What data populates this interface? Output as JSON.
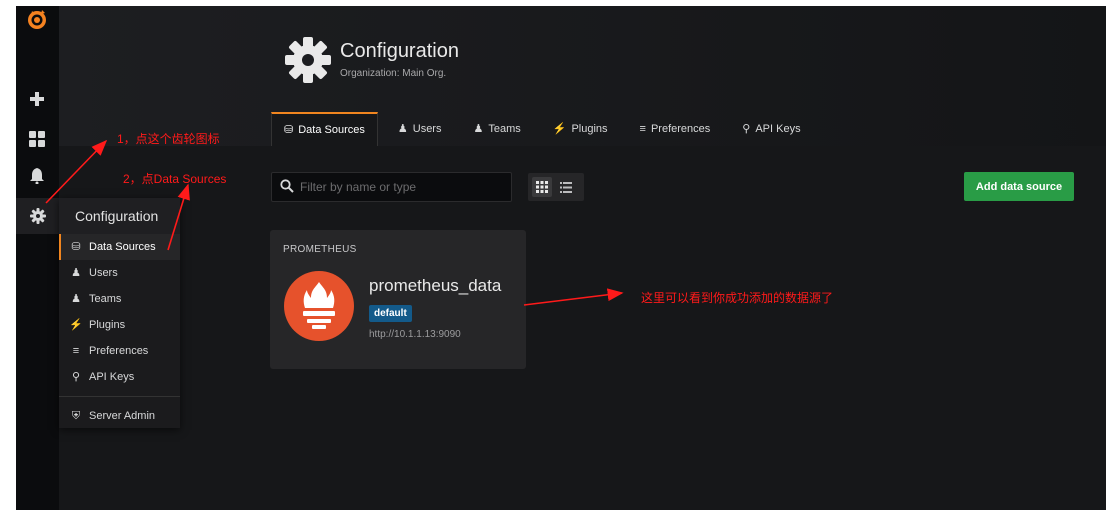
{
  "sidebar": {
    "icons": [
      "grafana-logo-icon",
      "plus-icon",
      "dashboards-icon",
      "bell-icon",
      "gear-icon"
    ]
  },
  "config_menu": {
    "title": "Configuration",
    "items": [
      {
        "label": "Data Sources",
        "icon": "database-icon",
        "active": true
      },
      {
        "label": "Users",
        "icon": "user-icon"
      },
      {
        "label": "Teams",
        "icon": "team-icon"
      },
      {
        "label": "Plugins",
        "icon": "plug-icon"
      },
      {
        "label": "Preferences",
        "icon": "sliders-icon"
      },
      {
        "label": "API Keys",
        "icon": "key-icon"
      }
    ],
    "server_admin": "Server Admin"
  },
  "header": {
    "title": "Configuration",
    "subtitle": "Organization: Main Org."
  },
  "tabs": [
    {
      "label": "Data Sources",
      "icon": "database-icon",
      "active": true
    },
    {
      "label": "Users",
      "icon": "user-icon"
    },
    {
      "label": "Teams",
      "icon": "team-icon"
    },
    {
      "label": "Plugins",
      "icon": "plug-icon"
    },
    {
      "label": "Preferences",
      "icon": "sliders-icon"
    },
    {
      "label": "API Keys",
      "icon": "key-icon"
    }
  ],
  "toolbar": {
    "search_placeholder": "Filter by name or type",
    "add_button": "Add data source"
  },
  "datasource": {
    "type": "PROMETHEUS",
    "name": "prometheus_data",
    "badge": "default",
    "url": "http://10.1.1.13:9090"
  },
  "annotations": {
    "step1": "1，点这个齿轮图标",
    "step2": "2，点Data Sources",
    "note": "这里可以看到你成功添加的数据源了"
  },
  "colors": {
    "accent": "#f0851f",
    "button_green": "#299c46",
    "annotation_red": "#ff1a1a",
    "prometheus": "#e6522c"
  }
}
